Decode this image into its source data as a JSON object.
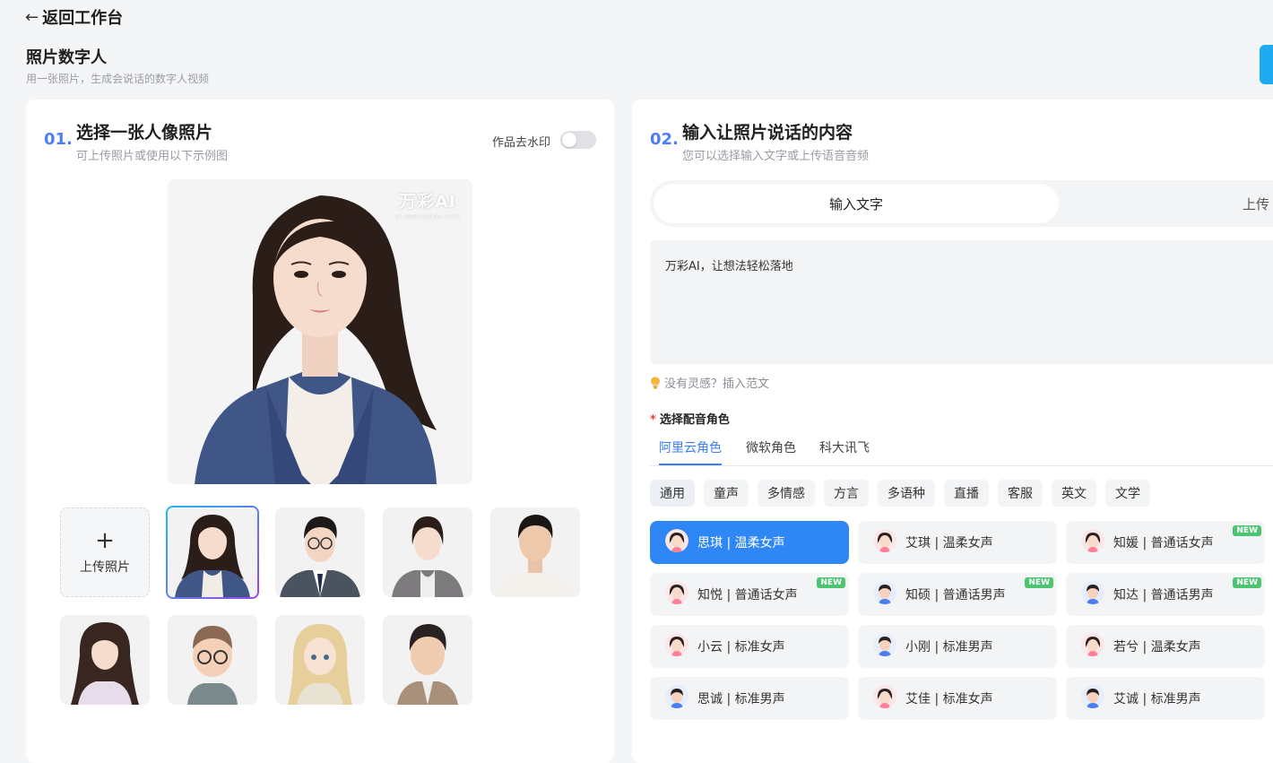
{
  "nav": {
    "back_label": "返回工作台"
  },
  "page": {
    "title": "照片数字人",
    "subtitle": "用一张照片，生成会说话的数字人视频"
  },
  "step1": {
    "num": "01.",
    "title": "选择一张人像照片",
    "subtitle": "可上传照片或使用以下示例图",
    "watermark_label": "作品去水印",
    "watermark_on": false,
    "preview_logo": "万彩AI",
    "preview_logo_url": "ai.wancaibao.com",
    "upload_label": "上传照片",
    "upload_icon": "plus-icon"
  },
  "step2": {
    "num": "02.",
    "title": "输入让照片说话的内容",
    "subtitle": "您可以选择输入文字或上传语音音频",
    "tabs": [
      "输入文字",
      "上传"
    ],
    "text_value": "万彩AI，让想法轻松落地",
    "inspiration": "没有灵感？插入范文",
    "voice_heading": "选择配音角色",
    "providers": [
      "阿里云角色",
      "微软角色",
      "科大讯飞"
    ],
    "categories": [
      "通用",
      "童声",
      "多情感",
      "方言",
      "多语种",
      "直播",
      "客服",
      "英文",
      "文学"
    ],
    "voices": [
      {
        "label": "思琪 | 温柔女声",
        "gender": "female",
        "new": false
      },
      {
        "label": "艾琪 | 温柔女声",
        "gender": "female",
        "new": false
      },
      {
        "label": "知媛 | 普通话女声",
        "gender": "female",
        "new": true
      },
      {
        "label": "知悦 | 普通话女声",
        "gender": "female",
        "new": true
      },
      {
        "label": "知硕 | 普通话男声",
        "gender": "male",
        "new": true
      },
      {
        "label": "知达 | 普通话男声",
        "gender": "male",
        "new": true
      },
      {
        "label": "小云 | 标准女声",
        "gender": "female",
        "new": false
      },
      {
        "label": "小刚 | 标准男声",
        "gender": "male",
        "new": false
      },
      {
        "label": "若兮 | 温柔女声",
        "gender": "female",
        "new": false
      },
      {
        "label": "思诚 | 标准男声",
        "gender": "male",
        "new": false
      },
      {
        "label": "艾佳 | 标准女声",
        "gender": "female",
        "new": false
      },
      {
        "label": "艾诚 | 标准男声",
        "gender": "male",
        "new": false
      }
    ],
    "new_badge": "NEW"
  },
  "colors": {
    "accent": "#2f87f5",
    "step_num": "#4e7cff",
    "new_badge": "#4cc472"
  }
}
